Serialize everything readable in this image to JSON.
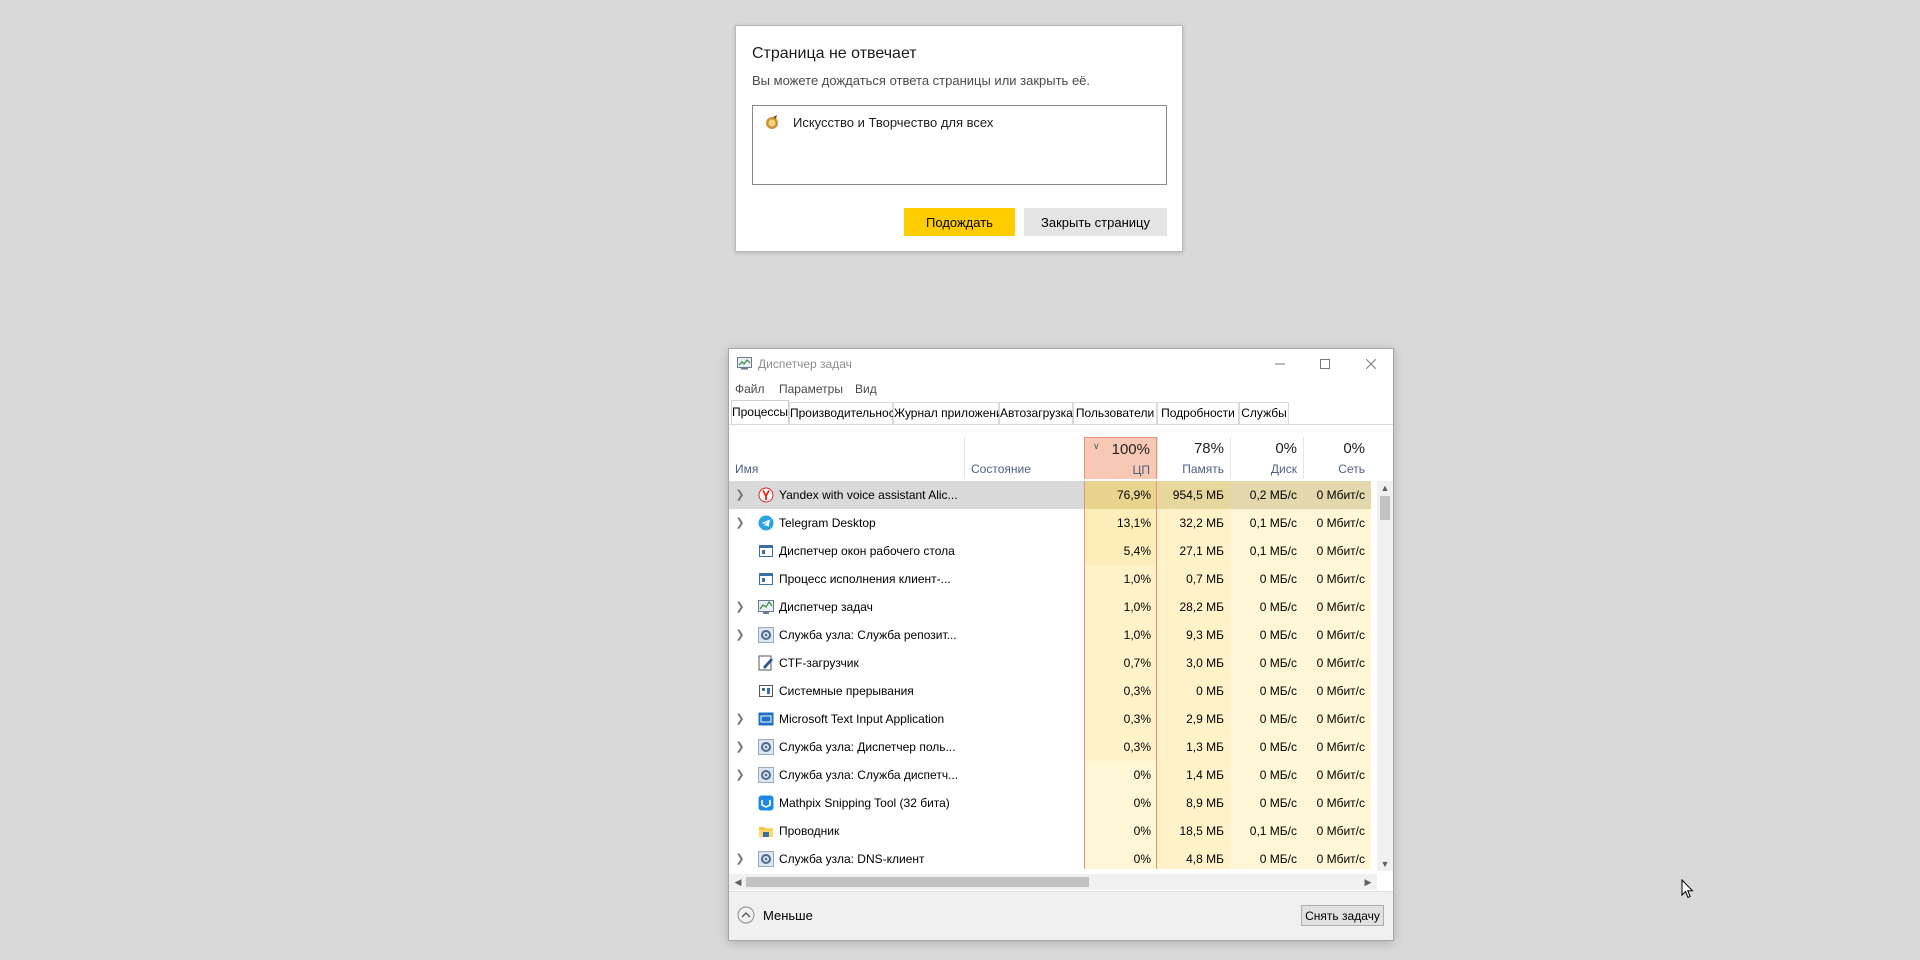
{
  "dialog": {
    "title": "Страница не отвечает",
    "subtitle": "Вы можете дождаться ответа страницы или закрыть её.",
    "page_item": "Искусство и Творчество для всех",
    "wait_button": "Подождать",
    "close_button": "Закрыть страницу",
    "accent_color": "#ffcc00"
  },
  "task_manager": {
    "title": "Диспетчер задач",
    "menu": [
      "Файл",
      "Параметры",
      "Вид"
    ],
    "tabs": [
      "Процессы",
      "Производительность",
      "Журнал приложений",
      "Автозагрузка",
      "Пользователи",
      "Подробности",
      "Службы"
    ],
    "active_tab": "Процессы",
    "columns": {
      "name": "Имя",
      "status": "Состояние",
      "cpu_pct": "100%",
      "cpu": "ЦП",
      "mem_pct": "78%",
      "mem": "Память",
      "disk_pct": "0%",
      "disk": "Диск",
      "net_pct": "0%",
      "net": "Сеть"
    },
    "processes": [
      {
        "name": "Yandex with voice assistant Alic...",
        "icon": "yandex-browser-icon",
        "expandable": true,
        "cpu": "76,9%",
        "mem": "954,5 МБ",
        "disk": "0,2 МБ/с",
        "net": "0 Мбит/с"
      },
      {
        "name": "Telegram Desktop",
        "icon": "telegram-icon",
        "expandable": true,
        "cpu": "13,1%",
        "mem": "32,2 МБ",
        "disk": "0,1 МБ/с",
        "net": "0 Мбит/с"
      },
      {
        "name": "Диспетчер окон рабочего стола",
        "icon": "system-window-icon",
        "expandable": false,
        "cpu": "5,4%",
        "mem": "27,1 МБ",
        "disk": "0,1 МБ/с",
        "net": "0 Мбит/с"
      },
      {
        "name": "Процесс исполнения клиент-...",
        "icon": "system-window-icon",
        "expandable": false,
        "cpu": "1,0%",
        "mem": "0,7 МБ",
        "disk": "0 МБ/с",
        "net": "0 Мбит/с"
      },
      {
        "name": "Диспетчер задач",
        "icon": "task-manager-icon",
        "expandable": true,
        "cpu": "1,0%",
        "mem": "28,2 МБ",
        "disk": "0 МБ/с",
        "net": "0 Мбит/с"
      },
      {
        "name": "Служба узла: Служба репозит...",
        "icon": "gear-icon",
        "expandable": true,
        "cpu": "1,0%",
        "mem": "9,3 МБ",
        "disk": "0 МБ/с",
        "net": "0 Мбит/с"
      },
      {
        "name": "CTF-загрузчик",
        "icon": "pen-icon",
        "expandable": false,
        "cpu": "0,7%",
        "mem": "3,0 МБ",
        "disk": "0 МБ/с",
        "net": "0 Мбит/с"
      },
      {
        "name": "Системные прерывания",
        "icon": "chip-icon",
        "expandable": false,
        "cpu": "0,3%",
        "mem": "0 МБ",
        "disk": "0 МБ/с",
        "net": "0 Мбит/с"
      },
      {
        "name": "Microsoft Text Input Application",
        "icon": "keyboard-icon",
        "expandable": true,
        "cpu": "0,3%",
        "mem": "2,9 МБ",
        "disk": "0 МБ/с",
        "net": "0 Мбит/с"
      },
      {
        "name": "Служба узла: Диспетчер поль...",
        "icon": "gear-icon",
        "expandable": true,
        "cpu": "0,3%",
        "mem": "1,3 МБ",
        "disk": "0 МБ/с",
        "net": "0 Мбит/с"
      },
      {
        "name": "Служба узла: Служба диспетч...",
        "icon": "gear-icon",
        "expandable": true,
        "cpu": "0%",
        "mem": "1,4 МБ",
        "disk": "0 МБ/с",
        "net": "0 Мбит/с"
      },
      {
        "name": "Mathpix Snipping Tool (32 бита)",
        "icon": "mathpix-icon",
        "expandable": false,
        "cpu": "0%",
        "mem": "8,9 МБ",
        "disk": "0 МБ/с",
        "net": "0 Мбит/с"
      },
      {
        "name": "Проводник",
        "icon": "folder-icon",
        "expandable": false,
        "cpu": "0%",
        "mem": "18,5 МБ",
        "disk": "0,1 МБ/с",
        "net": "0 Мбит/с"
      },
      {
        "name": "Служба узла: DNS-клиент",
        "icon": "gear-icon",
        "expandable": true,
        "cpu": "0%",
        "mem": "4,8 МБ",
        "disk": "0 МБ/с",
        "net": "0 Мбит/с"
      }
    ],
    "fewer_label": "Меньше",
    "end_task_button": "Снять задачу"
  }
}
